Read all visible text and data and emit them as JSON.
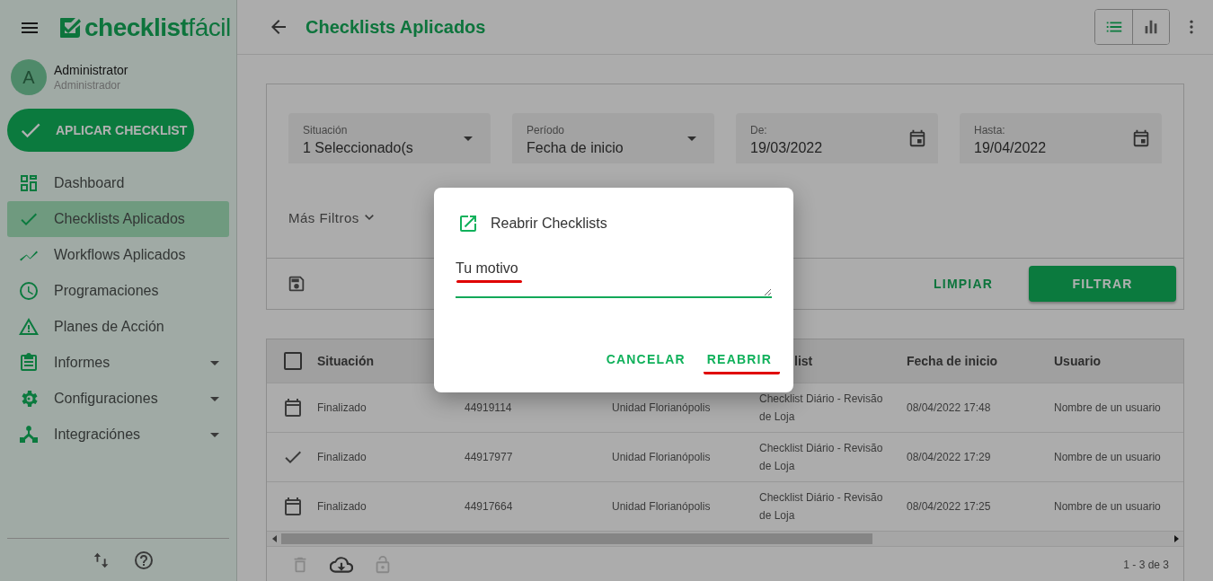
{
  "sidebar": {
    "logo": "**checklist**fácil",
    "user": {
      "initial": "A",
      "name": "Administrator",
      "role": "Administrador"
    },
    "apply_button": "APLICAR CHECKLIST",
    "items": [
      {
        "label": "Dashboard",
        "selected": false,
        "has_submenu": false
      },
      {
        "label": "Checklists Aplicados",
        "selected": true,
        "has_submenu": false
      },
      {
        "label": "Workflows Aplicados",
        "selected": false,
        "has_submenu": false
      },
      {
        "label": "Programaciones",
        "selected": false,
        "has_submenu": false
      },
      {
        "label": "Planes de Acción",
        "selected": false,
        "has_submenu": false
      },
      {
        "label": "Informes",
        "selected": false,
        "has_submenu": true
      },
      {
        "label": "Configuraciones",
        "selected": false,
        "has_submenu": true
      },
      {
        "label": "Integraciónes",
        "selected": false,
        "has_submenu": true
      }
    ]
  },
  "topbar": {
    "title": "Checklists Aplicados",
    "views": [
      {
        "selected": true
      },
      {
        "selected": false
      }
    ]
  },
  "filters": {
    "fields": [
      {
        "kind": "select",
        "label": "Situación",
        "value": "1 Seleccionado(s"
      },
      {
        "kind": "select",
        "label": "Período",
        "value": "Fecha de inicio"
      },
      {
        "kind": "date",
        "label": "De:",
        "value": "19/03/2022"
      },
      {
        "kind": "date",
        "label": "Hasta:",
        "value": "19/04/2022"
      }
    ],
    "more_filters": "Más Filtros",
    "clear_button": "LIMPIAR",
    "apply_button": "FILTRAR"
  },
  "table": {
    "select_all": {
      "checked": false
    },
    "columns": [
      {
        "label": "Situación"
      },
      {},
      {},
      {
        "label": "list"
      },
      {
        "label": "Fecha de inicio"
      },
      {
        "label": "Usuario"
      }
    ],
    "rows": [
      {
        "kind": "scheduled",
        "cells": [
          "Finalizado",
          "44919114",
          "Unidad Florianópolis",
          "Checklist Diário - Revisão de Loja",
          "08/04/2022 17:48",
          "Nombre de un usuario"
        ]
      },
      {
        "kind": "done",
        "cells": [
          "Finalizado",
          "44917977",
          "Unidad Florianópolis",
          "Checklist Diário - Revisão de Loja",
          "08/04/2022 17:29",
          "Nombre de un usuario"
        ]
      },
      {
        "kind": "scheduled",
        "cells": [
          "Finalizado",
          "44917664",
          "Unidad Florianópolis",
          "Checklist Diário - Revisão de Loja",
          "08/04/2022 17:25",
          "Nombre de un usuario"
        ]
      }
    ],
    "actions": [
      {
        "disabled": true
      },
      {
        "disabled": false
      },
      {
        "disabled": true
      }
    ],
    "pagination": "1 - 3 de 3"
  },
  "dialog": {
    "title": "Reabrir Checklists",
    "field": {
      "placeholder": "Tu motivo",
      "highlighted": true
    },
    "buttons": [
      {
        "label": "CANCELAR",
        "highlighted": false
      },
      {
        "label": "REABRIR",
        "highlighted": true
      }
    ]
  }
}
